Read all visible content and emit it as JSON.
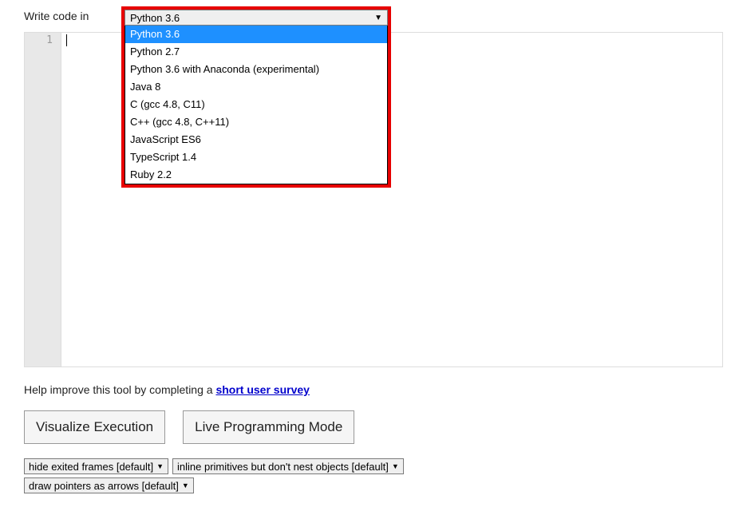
{
  "header": {
    "write_code_label": "Write code in"
  },
  "language_select": {
    "selected": "Python 3.6",
    "options": [
      "Python 3.6",
      "Python 2.7",
      "Python 3.6 with Anaconda (experimental)",
      "Java 8",
      "C (gcc 4.8, C11)",
      "C++ (gcc 4.8, C++11)",
      "JavaScript ES6",
      "TypeScript 1.4",
      "Ruby 2.2"
    ],
    "highlighted_index": 0
  },
  "editor": {
    "line_number": "1"
  },
  "help": {
    "prefix": "Help improve this tool by completing a ",
    "link_text": "short user survey"
  },
  "buttons": {
    "visualize": "Visualize Execution",
    "live_mode": "Live Programming Mode"
  },
  "options": {
    "frames": "hide exited frames [default]",
    "primitives": "inline primitives but don't nest objects [default]",
    "pointers": "draw pointers as arrows [default]"
  }
}
